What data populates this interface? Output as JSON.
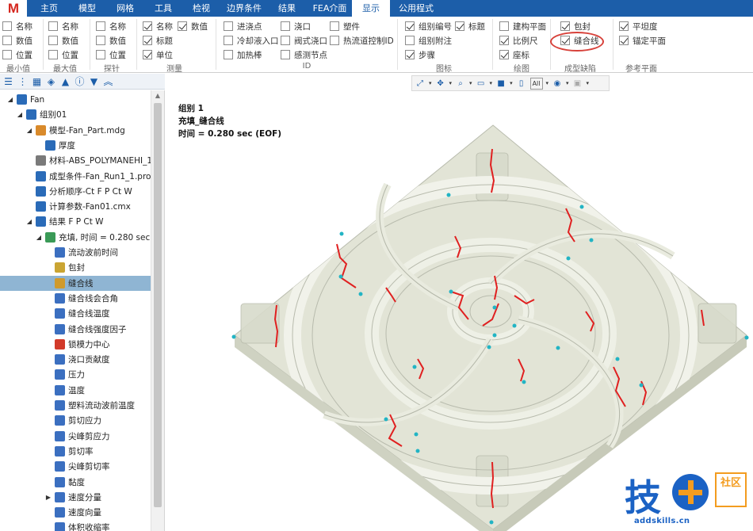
{
  "app": {
    "logo": "M"
  },
  "menu_tabs": [
    {
      "label": "主页",
      "active": false
    },
    {
      "label": "模型",
      "active": false
    },
    {
      "label": "网格",
      "active": false
    },
    {
      "label": "工具",
      "active": false
    },
    {
      "label": "检视",
      "active": false
    },
    {
      "label": "边界条件",
      "active": false
    },
    {
      "label": "结果",
      "active": false
    },
    {
      "label": "FEA介面",
      "active": false
    },
    {
      "label": "显示",
      "active": true
    },
    {
      "label": "公用程式",
      "active": false
    }
  ],
  "ribbon": {
    "groups": [
      {
        "label": "最小值",
        "items": [
          {
            "label": "名称",
            "checked": false
          },
          {
            "label": "数值",
            "checked": false
          },
          {
            "label": "位置",
            "checked": false
          }
        ]
      },
      {
        "label": "最大值",
        "items": [
          {
            "label": "名称",
            "checked": false
          },
          {
            "label": "数值",
            "checked": false
          },
          {
            "label": "位置",
            "checked": false
          }
        ]
      },
      {
        "label": "探针",
        "items": [
          {
            "label": "名称",
            "checked": false
          },
          {
            "label": "数值",
            "checked": false
          },
          {
            "label": "位置",
            "checked": false
          }
        ]
      },
      {
        "label": "测量",
        "items": [
          {
            "label": "名称",
            "checked": true
          },
          {
            "label": "数值",
            "checked": true
          },
          {
            "label": "标题",
            "checked": true
          },
          {
            "label": "单位",
            "checked": true
          }
        ]
      },
      {
        "label": "ID",
        "items": [
          {
            "label": "进浇点",
            "checked": false
          },
          {
            "label": "浇口",
            "checked": false
          },
          {
            "label": "塑件",
            "checked": false
          },
          {
            "label": "冷却液入口",
            "checked": false
          },
          {
            "label": "阀式浇口",
            "checked": false
          },
          {
            "label": "热流道控制ID",
            "checked": false
          },
          {
            "label": "加热棒",
            "checked": false
          },
          {
            "label": "感测节点",
            "checked": false
          }
        ]
      },
      {
        "label": "图标",
        "items": [
          {
            "label": "组别编号",
            "checked": true
          },
          {
            "label": "标题",
            "checked": true
          },
          {
            "label": "组别附注",
            "checked": false
          },
          {
            "label": "步骤",
            "checked": true
          }
        ]
      },
      {
        "label": "绘图",
        "items": [
          {
            "label": "建构平面",
            "checked": false
          },
          {
            "label": "比例尺",
            "checked": true
          },
          {
            "label": "座标",
            "checked": true
          }
        ]
      },
      {
        "label": "成型缺陷",
        "items": [
          {
            "label": "包封",
            "checked": true
          },
          {
            "label": "缝合线",
            "checked": true
          }
        ]
      },
      {
        "label": "参考平面",
        "items": [
          {
            "label": "平坦度",
            "checked": true
          },
          {
            "label": "锚定平面",
            "checked": true
          }
        ]
      }
    ]
  },
  "left_toolbar_icons": [
    "list-view-icon",
    "tree-view-icon",
    "grid-view-icon",
    "layer-icon",
    "flask-icon",
    "info-icon",
    "filter-icon",
    "collapse-icon"
  ],
  "tree": [
    {
      "label": "Fan",
      "level": 0,
      "twisty": "open",
      "icon": "folder-icon",
      "color": "#2a6bb8",
      "selected": false
    },
    {
      "label": "组别01",
      "level": 1,
      "twisty": "open",
      "icon": "group-icon",
      "color": "#2a6bb8",
      "selected": false
    },
    {
      "label": "模型-Fan_Part.mdg",
      "level": 2,
      "twisty": "open",
      "icon": "model-icon",
      "color": "#d98a2b",
      "selected": false
    },
    {
      "label": "厚度",
      "level": 3,
      "twisty": "",
      "icon": "thickness-icon",
      "color": "#2a6bb8",
      "selected": false
    },
    {
      "label": "材料-ABS_POLYMANEHI_1.…",
      "level": 2,
      "twisty": "",
      "icon": "material-icon",
      "color": "#7a7a7a",
      "selected": false
    },
    {
      "label": "成型条件-Fan_Run1_1.pro",
      "level": 2,
      "twisty": "",
      "icon": "process-icon",
      "color": "#2a6bb8",
      "selected": false
    },
    {
      "label": "分析顺序-Ct F P Ct W",
      "level": 2,
      "twisty": "",
      "icon": "sequence-icon",
      "color": "#2a6bb8",
      "selected": false
    },
    {
      "label": "计算参数-Fan01.cmx",
      "level": 2,
      "twisty": "",
      "icon": "parameter-icon",
      "color": "#2a6bb8",
      "selected": false
    },
    {
      "label": "结果 F P Ct W",
      "level": 2,
      "twisty": "open",
      "icon": "result-icon",
      "color": "#2a6bb8",
      "selected": false
    },
    {
      "label": "充填, 时间 = 0.280 sec (E…",
      "level": 3,
      "twisty": "open",
      "icon": "fill-icon",
      "color": "#3a9a57",
      "selected": false
    },
    {
      "label": "流动波前时间",
      "level": 4,
      "twisty": "",
      "icon": "result-item-icon",
      "color": "#3b6fc0",
      "selected": false
    },
    {
      "label": "包封",
      "level": 4,
      "twisty": "",
      "icon": "air-trap-icon",
      "color": "#caa533",
      "selected": false
    },
    {
      "label": "缝合线",
      "level": 4,
      "twisty": "",
      "icon": "weld-line-icon",
      "color": "#d09a2c",
      "selected": true
    },
    {
      "label": "缝合线会合角",
      "level": 4,
      "twisty": "",
      "icon": "result-item-icon",
      "color": "#3b6fc0",
      "selected": false
    },
    {
      "label": "缝合线温度",
      "level": 4,
      "twisty": "",
      "icon": "result-item-icon",
      "color": "#3b6fc0",
      "selected": false
    },
    {
      "label": "缝合线强度因子",
      "level": 4,
      "twisty": "",
      "icon": "result-item-icon",
      "color": "#3b6fc0",
      "selected": false
    },
    {
      "label": "锁模力中心",
      "level": 4,
      "twisty": "",
      "icon": "crosshair-icon",
      "color": "#d23a2a",
      "selected": false
    },
    {
      "label": "浇口贡献度",
      "level": 4,
      "twisty": "",
      "icon": "result-item-icon",
      "color": "#3b6fc0",
      "selected": false
    },
    {
      "label": "压力",
      "level": 4,
      "twisty": "",
      "icon": "result-item-icon",
      "color": "#3b6fc0",
      "selected": false
    },
    {
      "label": "温度",
      "level": 4,
      "twisty": "",
      "icon": "result-item-icon",
      "color": "#3b6fc0",
      "selected": false
    },
    {
      "label": "塑料流动波前温度",
      "level": 4,
      "twisty": "",
      "icon": "result-item-icon",
      "color": "#3b6fc0",
      "selected": false
    },
    {
      "label": "剪切应力",
      "level": 4,
      "twisty": "",
      "icon": "result-item-icon",
      "color": "#3b6fc0",
      "selected": false
    },
    {
      "label": "尖峰剪应力",
      "level": 4,
      "twisty": "",
      "icon": "result-item-icon",
      "color": "#3b6fc0",
      "selected": false
    },
    {
      "label": "剪切率",
      "level": 4,
      "twisty": "",
      "icon": "result-item-icon",
      "color": "#3b6fc0",
      "selected": false
    },
    {
      "label": "尖峰剪切率",
      "level": 4,
      "twisty": "",
      "icon": "result-item-icon",
      "color": "#3b6fc0",
      "selected": false
    },
    {
      "label": "黏度",
      "level": 4,
      "twisty": "",
      "icon": "result-item-icon",
      "color": "#3b6fc0",
      "selected": false
    },
    {
      "label": "速度分量",
      "level": 4,
      "twisty": "closed",
      "icon": "result-item-icon",
      "color": "#3b6fc0",
      "selected": false
    },
    {
      "label": "速度向量",
      "level": 4,
      "twisty": "",
      "icon": "result-item-icon",
      "color": "#3b6fc0",
      "selected": false
    },
    {
      "label": "体积收缩率",
      "level": 4,
      "twisty": "",
      "icon": "result-item-icon",
      "color": "#3b6fc0",
      "selected": false
    }
  ],
  "view_toolbar": {
    "buttons": [
      "fit-view-icon",
      "pan-icon",
      "zoom-icon",
      "window-icon",
      "cube-view-icon",
      "page-icon",
      "display-all-icon",
      "eye-icon",
      "shade-icon"
    ],
    "all_label": "All"
  },
  "viewport": {
    "group_label": "组别 1",
    "result_label": "充填_缝合线",
    "time_label": "时间 = 0.280 sec (EOF)"
  },
  "watermark": {
    "char": "技",
    "community": "社区",
    "url": "addskills.cn"
  },
  "colors": {
    "brand_blue": "#1c5ea9",
    "weld_line": "#e02020",
    "sensor_node": "#22b4c4",
    "selection": "#8fb5d3",
    "highlight_ring": "#d7413a"
  }
}
